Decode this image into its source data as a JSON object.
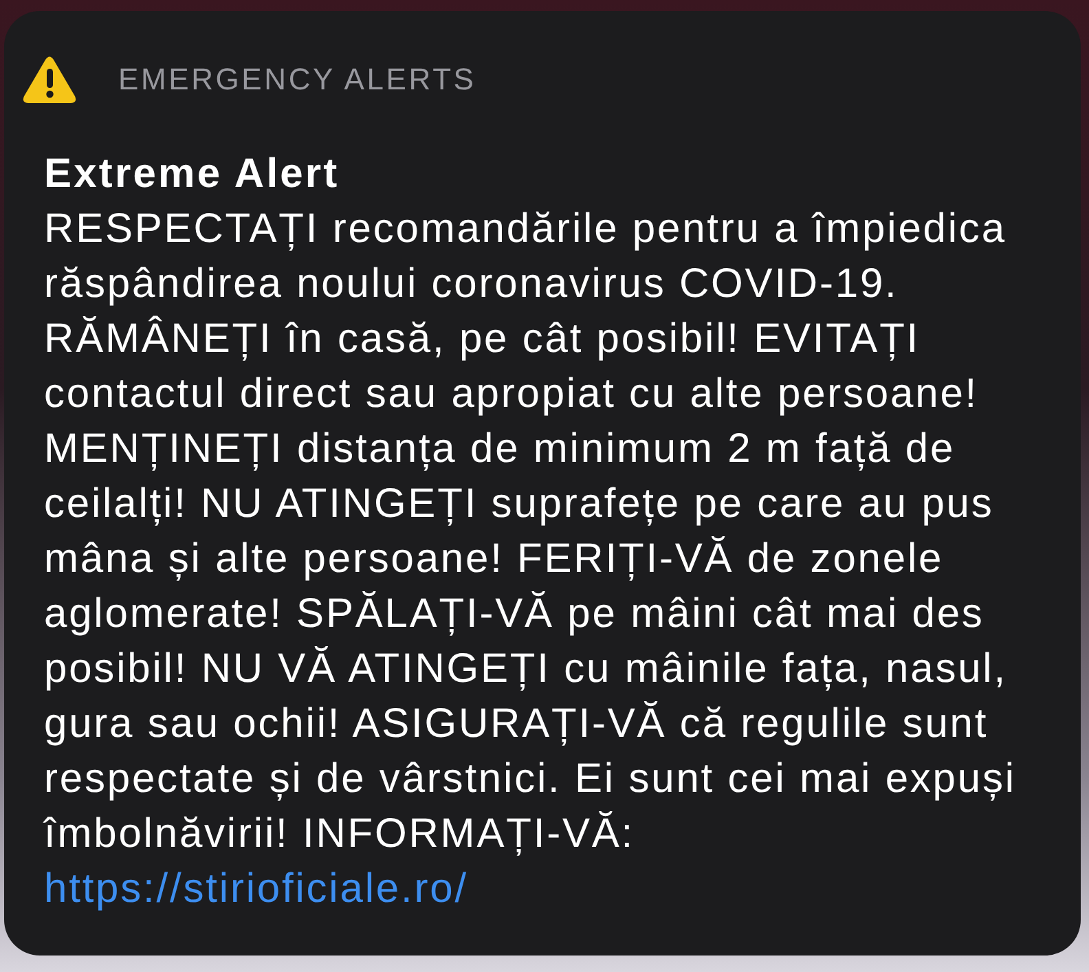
{
  "header": {
    "app_name": "EMERGENCY ALERTS"
  },
  "alert": {
    "title": "Extreme Alert",
    "body": "RESPECTAȚI recomandările pentru a împiedica răspândirea noului coronavirus COVID-19. RĂMÂNEȚI în casă, pe cât posibil! EVITAȚI contactul direct sau apropiat cu alte persoane! MENȚINEȚI distanța de minimum 2 m față de ceilalți! NU ATINGEȚI suprafețe pe care au pus mâna și alte persoane! FERIȚI-VĂ de zonele aglomerate! SPĂLAȚI-VĂ pe mâini cât mai des posibil! NU VĂ ATINGEȚI cu mâinile fața, nasul, gura sau ochii! ASIGURAȚI-VĂ că regulile sunt respectate și de vârstnici. Ei sunt cei mai expuși îmbolnăvirii! INFORMAȚI-VĂ:",
    "link": "https://stirioficiale.ro/"
  }
}
